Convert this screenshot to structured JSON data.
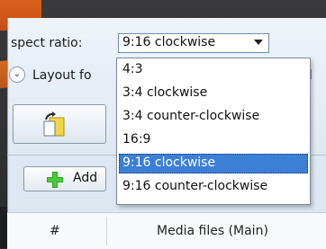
{
  "aspect_label": "spect ratio:",
  "combo": {
    "value": "9:16 clockwise"
  },
  "layout_label": "Layout fo",
  "trunc_label": "nl",
  "add_button": {
    "label": "Add"
  },
  "grid": {
    "columns": [
      "#",
      "Media files (Main)"
    ]
  },
  "dropdown": {
    "options": [
      "4:3",
      "3:4 clockwise",
      "3:4 counter-clockwise",
      "16:9",
      "9:16 clockwise",
      "9:16 counter-clockwise"
    ],
    "selected_index": 4
  },
  "colors": {
    "accent_orange": "#d9601e",
    "selection_blue": "#3c7fd6",
    "plus_green": "#29a81f"
  },
  "icons": {
    "expander": "chevron-down-icon",
    "tool": "rotate-page-icon",
    "add": "plus-icon"
  }
}
